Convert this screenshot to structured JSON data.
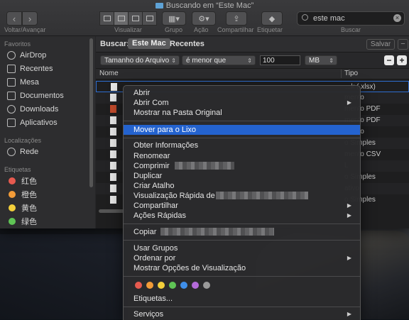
{
  "window": {
    "title": "Buscando em “Este Mac”"
  },
  "toolbar": {
    "back_forward_label": "Voltar/Avançar",
    "view_label": "Visualizar",
    "group_label": "Grupo",
    "action_label": "Ação",
    "share_label": "Compartilhar",
    "tags_label": "Etiquetar",
    "search_label": "Buscar"
  },
  "search": {
    "value": "este mac"
  },
  "sidebar": {
    "favorites_head": "Favoritos",
    "favorites": [
      {
        "label": "AirDrop",
        "icon": "airdrop-icon"
      },
      {
        "label": "Recentes",
        "icon": "clock-icon"
      },
      {
        "label": "Mesa",
        "icon": "desktop-icon"
      },
      {
        "label": "Documentos",
        "icon": "document-icon"
      },
      {
        "label": "Downloads",
        "icon": "download-icon"
      },
      {
        "label": "Aplicativos",
        "icon": "apps-icon"
      }
    ],
    "locations_head": "Localizações",
    "locations": [
      {
        "label": "Rede",
        "icon": "globe-icon"
      }
    ],
    "tags_head": "Etiquetas",
    "tags": [
      {
        "label": "红色",
        "color": "#e65a4f"
      },
      {
        "label": "橙色",
        "color": "#f29b38"
      },
      {
        "label": "黄色",
        "color": "#f3cf3b"
      },
      {
        "label": "绿色",
        "color": "#5fc455"
      }
    ]
  },
  "scope": {
    "label": "Buscar:",
    "active": "Este Mac",
    "other": "Recentes",
    "save": "Salvar",
    "minus": "−"
  },
  "criteria": {
    "attribute": "Tamanho do Arquivo",
    "operator": "é menor que",
    "value": "100",
    "unit": "MB",
    "minus": "−",
    "plus": "+"
  },
  "columns": {
    "name": "Nome",
    "kind": "Tipo"
  },
  "rows": [
    {
      "kind": "...k (.xlsx)"
    },
    {
      "kind": "mento"
    },
    {
      "kind": "mento PDF"
    },
    {
      "kind": "mento PDF"
    },
    {
      "kind": "mento"
    },
    {
      "kind": "o Simples"
    },
    {
      "kind": "mento CSV"
    },
    {
      "kind": "L"
    },
    {
      "kind": "o Simples"
    },
    {
      "kind": "ativo"
    },
    {
      "kind": "o Simples"
    }
  ],
  "context_menu": {
    "open": "Abrir",
    "open_with": "Abrir Com",
    "show_original": "Mostrar na Pasta Original",
    "move_to_trash": "Mover para o Lixo",
    "get_info": "Obter Informações",
    "rename": "Renomear",
    "compress": "Comprimir",
    "duplicate": "Duplicar",
    "make_alias": "Criar Atalho",
    "quick_look": "Visualização Rápida de",
    "share": "Compartilhar",
    "quick_actions": "Ações Rápidas",
    "copy": "Copiar",
    "use_groups": "Usar Grupos",
    "sort_by": "Ordenar por",
    "show_view_options": "Mostrar Opções de Visualização",
    "tags": "Etiquetas...",
    "services": "Serviços",
    "tag_colors": [
      "#e65a4f",
      "#f29b38",
      "#f3cf3b",
      "#5fc455",
      "#3f8fea",
      "#b46ad9",
      "#9a9a9a"
    ]
  }
}
